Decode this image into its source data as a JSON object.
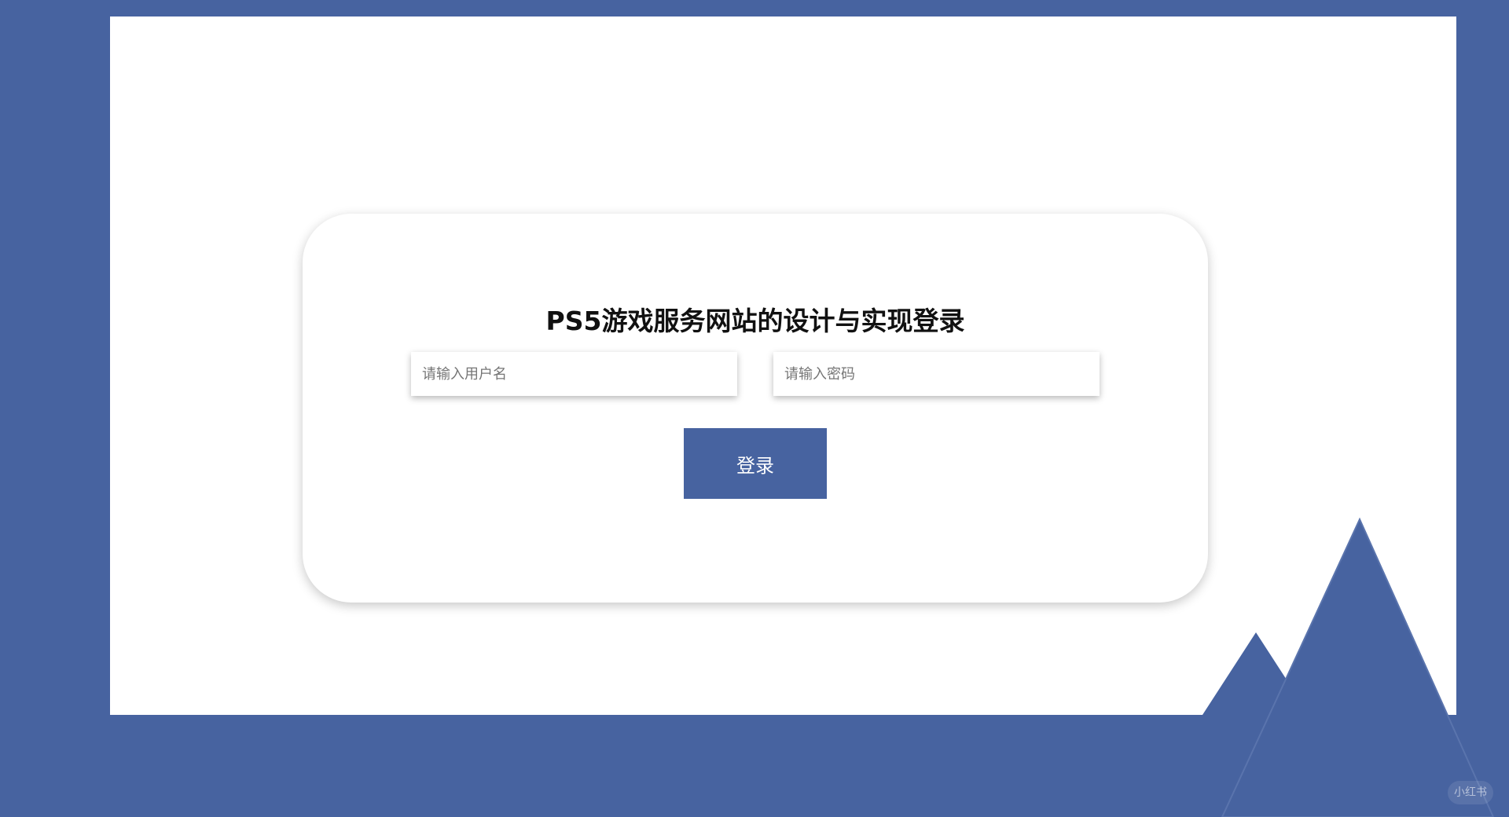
{
  "login": {
    "title": "PS5游戏服务网站的设计与实现登录",
    "username_placeholder": "请输入用户名",
    "password_placeholder": "请输入密码",
    "submit_label": "登录"
  },
  "watermark": {
    "text": "小红书"
  },
  "colors": {
    "background": "#4763a0",
    "panel": "#ffffff",
    "button": "#4763a0",
    "button_text": "#ffffff",
    "title": "#111111"
  }
}
